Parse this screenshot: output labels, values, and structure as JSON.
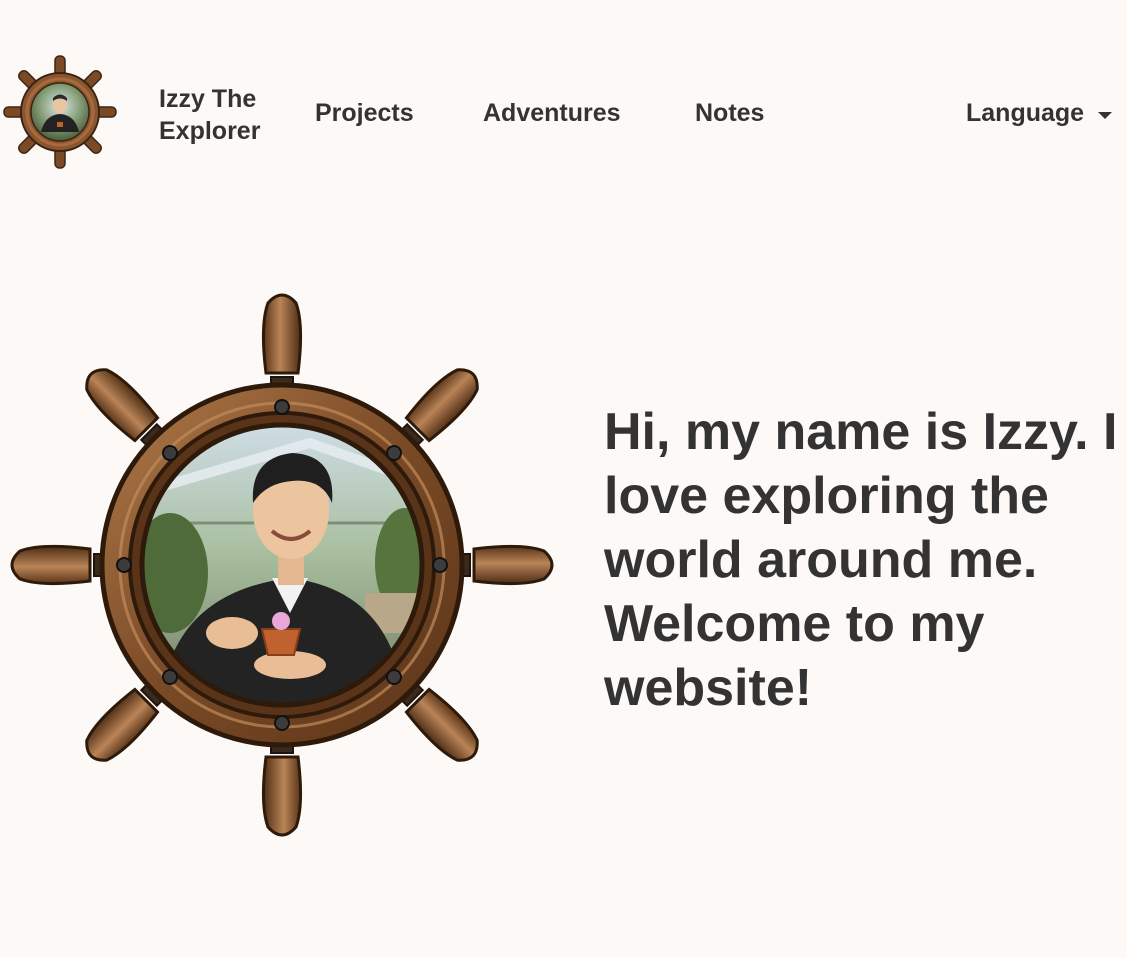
{
  "header": {
    "brand": "Izzy The Explorer",
    "nav": {
      "projects": "Projects",
      "adventures": "Adventures",
      "notes": "Notes"
    },
    "language": {
      "label": "Language",
      "icon": "chevron-down-icon"
    }
  },
  "hero": {
    "greeting": "Hi, my name is Izzy. I love exploring the world around me. Welcome to my website!"
  },
  "colors": {
    "background": "#fcf9f6",
    "text": "#333333",
    "wheel_wood": "#7a4a26",
    "wheel_wood_light": "#a66c3b",
    "wheel_metal": "#444444"
  }
}
